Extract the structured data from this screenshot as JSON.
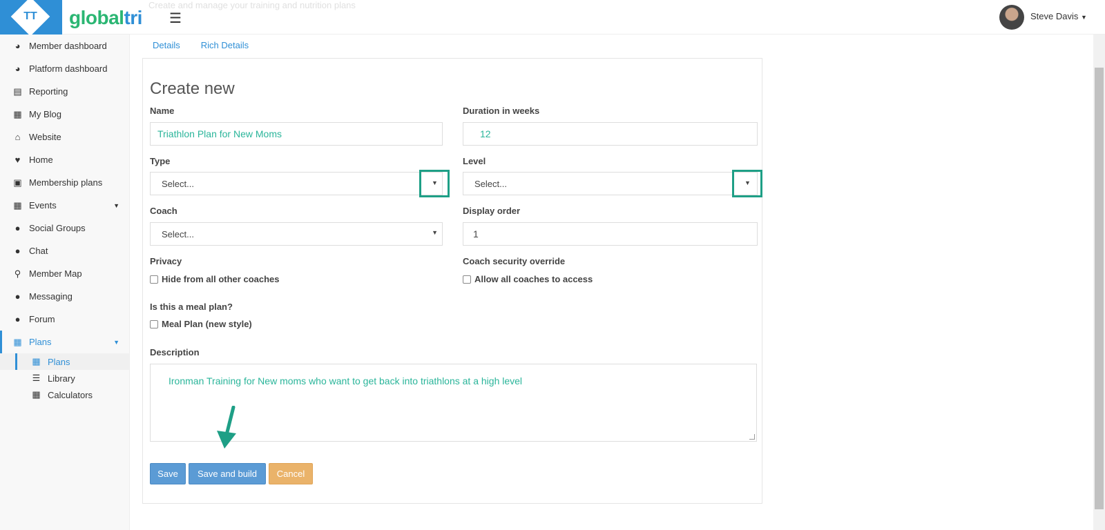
{
  "header": {
    "logo_text": "TT",
    "brand_part1": "global",
    "brand_part2": "tri",
    "faded_text": "Create and manage your training and nutrition plans",
    "user_name": "Steve Davis"
  },
  "sidebar": {
    "items": [
      {
        "label": "Member dashboard",
        "icon": "dashboard-icon"
      },
      {
        "label": "Platform dashboard",
        "icon": "dashboard-icon"
      },
      {
        "label": "Reporting",
        "icon": "bar-chart-icon"
      },
      {
        "label": "My Blog",
        "icon": "newspaper-icon"
      },
      {
        "label": "Website",
        "icon": "home-icon"
      },
      {
        "label": "Home",
        "icon": "heartbeat-icon"
      },
      {
        "label": "Membership plans",
        "icon": "money-icon"
      },
      {
        "label": "Events",
        "icon": "calendar-icon"
      },
      {
        "label": "Social Groups",
        "icon": "users-icon"
      },
      {
        "label": "Chat",
        "icon": "comments-icon"
      },
      {
        "label": "Member Map",
        "icon": "map-marker-icon"
      },
      {
        "label": "Messaging",
        "icon": "comment-icon"
      },
      {
        "label": "Forum",
        "icon": "comments-icon"
      },
      {
        "label": "Plans",
        "icon": "grid-icon"
      }
    ],
    "sub_items": [
      {
        "label": "Plans",
        "icon": "grid-icon"
      },
      {
        "label": "Library",
        "icon": "list-icon"
      },
      {
        "label": "Calculators",
        "icon": "calculator-icon"
      }
    ]
  },
  "tabs": [
    {
      "label": "Details"
    },
    {
      "label": "Rich Details"
    }
  ],
  "form": {
    "title": "Create new",
    "name_label": "Name",
    "name_value": "Triathlon Plan for New Moms",
    "duration_label": "Duration in weeks",
    "duration_value": "12",
    "type_label": "Type",
    "type_value": "Select...",
    "level_label": "Level",
    "level_value": "Select...",
    "coach_label": "Coach",
    "coach_value": "Select...",
    "display_order_label": "Display order",
    "display_order_value": "1",
    "privacy_label": "Privacy",
    "privacy_check": "Hide from all other coaches",
    "override_label": "Coach security override",
    "override_check": "Allow all coaches to access",
    "meal_label": "Is this a meal plan?",
    "meal_check": "Meal Plan (new style)",
    "description_label": "Description",
    "description_value": "Ironman Training for New moms who want to get back into triathlons at a high level"
  },
  "buttons": {
    "save": "Save",
    "save_build": "Save and build",
    "cancel": "Cancel"
  },
  "colors": {
    "primary": "#2f8fd6",
    "accent_green": "#2ab59a",
    "highlight_box": "#1e9f86",
    "cancel": "#eab36a"
  }
}
